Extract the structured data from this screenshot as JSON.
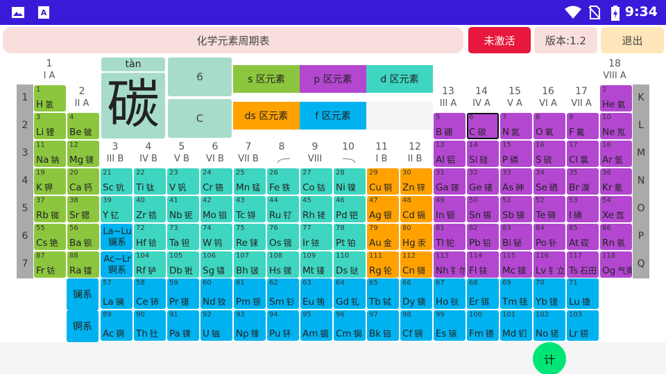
{
  "status_bar": {
    "time": "9:34",
    "icons": [
      "image-icon",
      "text-a-icon",
      "wifi-icon",
      "no-sim-icon",
      "battery-charging-icon"
    ]
  },
  "header": {
    "title": "化学元素周期表",
    "activate": "未激活",
    "version": "版本:1.2",
    "exit": "退出"
  },
  "detail": {
    "pinyin": "tàn",
    "character": "碳",
    "number": "6",
    "symbol": "C"
  },
  "legend": {
    "s": "s 区元素",
    "p": "p 区元素",
    "d": "d 区元素",
    "ds": "ds 区元素",
    "f": "f 区元素"
  },
  "periods": [
    "1",
    "2",
    "3",
    "4",
    "5",
    "6",
    "7"
  ],
  "shells": [
    "K",
    "L",
    "M",
    "N",
    "O",
    "P",
    "Q"
  ],
  "groups": [
    {
      "n": "1",
      "r": "I A"
    },
    {
      "n": "2",
      "r": "II A"
    },
    {
      "n": "3",
      "r": "III B"
    },
    {
      "n": "4",
      "r": "IV B"
    },
    {
      "n": "5",
      "r": "V B"
    },
    {
      "n": "6",
      "r": "VI B"
    },
    {
      "n": "7",
      "r": "VII B"
    },
    {
      "n": "8",
      "r": ""
    },
    {
      "n": "9",
      "r": "VIII"
    },
    {
      "n": "10",
      "r": ""
    },
    {
      "n": "11",
      "r": "I B"
    },
    {
      "n": "12",
      "r": "II B"
    },
    {
      "n": "13",
      "r": "III A"
    },
    {
      "n": "14",
      "r": "IV A"
    },
    {
      "n": "15",
      "r": "V A"
    },
    {
      "n": "16",
      "r": "VI A"
    },
    {
      "n": "17",
      "r": "VII A"
    },
    {
      "n": "18",
      "r": "VIII A"
    }
  ],
  "lan_ref": "La~Lu 镧系",
  "act_ref": "Ac~Lr 锕系",
  "series_labels": {
    "lanthanides": "镧系",
    "actinides": "锕系"
  },
  "elements": [
    {
      "z": "1",
      "s": "H",
      "c": "氢",
      "g": 1,
      "p": 1,
      "b": "s"
    },
    {
      "z": "2",
      "s": "He",
      "c": "氦",
      "g": 18,
      "p": 1,
      "b": "p"
    },
    {
      "z": "3",
      "s": "Li",
      "c": "锂",
      "g": 1,
      "p": 2,
      "b": "s"
    },
    {
      "z": "4",
      "s": "Be",
      "c": "铍",
      "g": 2,
      "p": 2,
      "b": "s"
    },
    {
      "z": "5",
      "s": "B",
      "c": "硼",
      "g": 13,
      "p": 2,
      "b": "p"
    },
    {
      "z": "6",
      "s": "C",
      "c": "碳",
      "g": 14,
      "p": 2,
      "b": "p",
      "sel": true
    },
    {
      "z": "7",
      "s": "N",
      "c": "氮",
      "g": 15,
      "p": 2,
      "b": "p"
    },
    {
      "z": "8",
      "s": "O",
      "c": "氧",
      "g": 16,
      "p": 2,
      "b": "p"
    },
    {
      "z": "9",
      "s": "F",
      "c": "氟",
      "g": 17,
      "p": 2,
      "b": "p"
    },
    {
      "z": "10",
      "s": "Ne",
      "c": "氖",
      "g": 18,
      "p": 2,
      "b": "p"
    },
    {
      "z": "11",
      "s": "Na",
      "c": "钠",
      "g": 1,
      "p": 3,
      "b": "s"
    },
    {
      "z": "12",
      "s": "Mg",
      "c": "镁",
      "g": 2,
      "p": 3,
      "b": "s"
    },
    {
      "z": "13",
      "s": "Al",
      "c": "铝",
      "g": 13,
      "p": 3,
      "b": "p"
    },
    {
      "z": "14",
      "s": "Si",
      "c": "硅",
      "g": 14,
      "p": 3,
      "b": "p"
    },
    {
      "z": "15",
      "s": "P",
      "c": "磷",
      "g": 15,
      "p": 3,
      "b": "p"
    },
    {
      "z": "16",
      "s": "S",
      "c": "硫",
      "g": 16,
      "p": 3,
      "b": "p"
    },
    {
      "z": "17",
      "s": "Cl",
      "c": "氯",
      "g": 17,
      "p": 3,
      "b": "p"
    },
    {
      "z": "18",
      "s": "Ar",
      "c": "氩",
      "g": 18,
      "p": 3,
      "b": "p"
    },
    {
      "z": "19",
      "s": "K",
      "c": "钾",
      "g": 1,
      "p": 4,
      "b": "s"
    },
    {
      "z": "20",
      "s": "Ca",
      "c": "钙",
      "g": 2,
      "p": 4,
      "b": "s"
    },
    {
      "z": "21",
      "s": "Sc",
      "c": "钪",
      "g": 3,
      "p": 4,
      "b": "d"
    },
    {
      "z": "22",
      "s": "Ti",
      "c": "钛",
      "g": 4,
      "p": 4,
      "b": "d"
    },
    {
      "z": "23",
      "s": "V",
      "c": "钒",
      "g": 5,
      "p": 4,
      "b": "d"
    },
    {
      "z": "24",
      "s": "Cr",
      "c": "铬",
      "g": 6,
      "p": 4,
      "b": "d"
    },
    {
      "z": "25",
      "s": "Mn",
      "c": "锰",
      "g": 7,
      "p": 4,
      "b": "d"
    },
    {
      "z": "26",
      "s": "Fe",
      "c": "铁",
      "g": 8,
      "p": 4,
      "b": "d"
    },
    {
      "z": "27",
      "s": "Co",
      "c": "钴",
      "g": 9,
      "p": 4,
      "b": "d"
    },
    {
      "z": "28",
      "s": "Ni",
      "c": "镍",
      "g": 10,
      "p": 4,
      "b": "d"
    },
    {
      "z": "29",
      "s": "Cu",
      "c": "铜",
      "g": 11,
      "p": 4,
      "b": "ds"
    },
    {
      "z": "30",
      "s": "Zn",
      "c": "锌",
      "g": 12,
      "p": 4,
      "b": "ds"
    },
    {
      "z": "31",
      "s": "Ga",
      "c": "镓",
      "g": 13,
      "p": 4,
      "b": "p"
    },
    {
      "z": "32",
      "s": "Ge",
      "c": "锗",
      "g": 14,
      "p": 4,
      "b": "p"
    },
    {
      "z": "33",
      "s": "As",
      "c": "砷",
      "g": 15,
      "p": 4,
      "b": "p"
    },
    {
      "z": "34",
      "s": "Se",
      "c": "硒",
      "g": 16,
      "p": 4,
      "b": "p"
    },
    {
      "z": "35",
      "s": "Br",
      "c": "溴",
      "g": 17,
      "p": 4,
      "b": "p"
    },
    {
      "z": "36",
      "s": "Kr",
      "c": "氪",
      "g": 18,
      "p": 4,
      "b": "p"
    },
    {
      "z": "37",
      "s": "Rb",
      "c": "铷",
      "g": 1,
      "p": 5,
      "b": "s"
    },
    {
      "z": "38",
      "s": "Sr",
      "c": "锶",
      "g": 2,
      "p": 5,
      "b": "s"
    },
    {
      "z": "39",
      "s": "Y",
      "c": "钇",
      "g": 3,
      "p": 5,
      "b": "d"
    },
    {
      "z": "40",
      "s": "Zr",
      "c": "锆",
      "g": 4,
      "p": 5,
      "b": "d"
    },
    {
      "z": "41",
      "s": "Nb",
      "c": "铌",
      "g": 5,
      "p": 5,
      "b": "d"
    },
    {
      "z": "42",
      "s": "Mo",
      "c": "钼",
      "g": 6,
      "p": 5,
      "b": "d"
    },
    {
      "z": "43",
      "s": "Tc",
      "c": "锝",
      "g": 7,
      "p": 5,
      "b": "d"
    },
    {
      "z": "44",
      "s": "Ru",
      "c": "钌",
      "g": 8,
      "p": 5,
      "b": "d"
    },
    {
      "z": "45",
      "s": "Rh",
      "c": "铑",
      "g": 9,
      "p": 5,
      "b": "d"
    },
    {
      "z": "46",
      "s": "Pd",
      "c": "钯",
      "g": 10,
      "p": 5,
      "b": "d"
    },
    {
      "z": "47",
      "s": "Ag",
      "c": "银",
      "g": 11,
      "p": 5,
      "b": "ds"
    },
    {
      "z": "48",
      "s": "Cd",
      "c": "镉",
      "g": 12,
      "p": 5,
      "b": "ds"
    },
    {
      "z": "49",
      "s": "In",
      "c": "铟",
      "g": 13,
      "p": 5,
      "b": "p"
    },
    {
      "z": "50",
      "s": "Sn",
      "c": "锡",
      "g": 14,
      "p": 5,
      "b": "p"
    },
    {
      "z": "51",
      "s": "Sb",
      "c": "锑",
      "g": 15,
      "p": 5,
      "b": "p"
    },
    {
      "z": "52",
      "s": "Te",
      "c": "碲",
      "g": 16,
      "p": 5,
      "b": "p"
    },
    {
      "z": "53",
      "s": "I",
      "c": "碘",
      "g": 17,
      "p": 5,
      "b": "p"
    },
    {
      "z": "54",
      "s": "Xe",
      "c": "氙",
      "g": 18,
      "p": 5,
      "b": "p"
    },
    {
      "z": "55",
      "s": "Cs",
      "c": "铯",
      "g": 1,
      "p": 6,
      "b": "s"
    },
    {
      "z": "56",
      "s": "Ba",
      "c": "钡",
      "g": 2,
      "p": 6,
      "b": "s"
    },
    {
      "z": "72",
      "s": "Hf",
      "c": "铪",
      "g": 4,
      "p": 6,
      "b": "d"
    },
    {
      "z": "73",
      "s": "Ta",
      "c": "钽",
      "g": 5,
      "p": 6,
      "b": "d"
    },
    {
      "z": "74",
      "s": "W",
      "c": "钨",
      "g": 6,
      "p": 6,
      "b": "d"
    },
    {
      "z": "75",
      "s": "Re",
      "c": "铼",
      "g": 7,
      "p": 6,
      "b": "d"
    },
    {
      "z": "76",
      "s": "Os",
      "c": "锇",
      "g": 8,
      "p": 6,
      "b": "d"
    },
    {
      "z": "77",
      "s": "Ir",
      "c": "铱",
      "g": 9,
      "p": 6,
      "b": "d"
    },
    {
      "z": "78",
      "s": "Pt",
      "c": "铂",
      "g": 10,
      "p": 6,
      "b": "d"
    },
    {
      "z": "79",
      "s": "Au",
      "c": "金",
      "g": 11,
      "p": 6,
      "b": "ds"
    },
    {
      "z": "80",
      "s": "Hg",
      "c": "汞",
      "g": 12,
      "p": 6,
      "b": "ds"
    },
    {
      "z": "81",
      "s": "Tl",
      "c": "铊",
      "g": 13,
      "p": 6,
      "b": "p"
    },
    {
      "z": "82",
      "s": "Pb",
      "c": "铅",
      "g": 14,
      "p": 6,
      "b": "p"
    },
    {
      "z": "83",
      "s": "Bi",
      "c": "铋",
      "g": 15,
      "p": 6,
      "b": "p"
    },
    {
      "z": "84",
      "s": "Po",
      "c": "钋",
      "g": 16,
      "p": 6,
      "b": "p"
    },
    {
      "z": "85",
      "s": "At",
      "c": "砹",
      "g": 17,
      "p": 6,
      "b": "p"
    },
    {
      "z": "86",
      "s": "Rn",
      "c": "氡",
      "g": 18,
      "p": 6,
      "b": "p"
    },
    {
      "z": "87",
      "s": "Fr",
      "c": "钫",
      "g": 1,
      "p": 7,
      "b": "s"
    },
    {
      "z": "88",
      "s": "Ra",
      "c": "镭",
      "g": 2,
      "p": 7,
      "b": "s"
    },
    {
      "z": "104",
      "s": "Rf",
      "c": "𬬻",
      "g": 4,
      "p": 7,
      "b": "d"
    },
    {
      "z": "105",
      "s": "Db",
      "c": "𬭊",
      "g": 5,
      "p": 7,
      "b": "d"
    },
    {
      "z": "106",
      "s": "Sg",
      "c": "𬭳",
      "g": 6,
      "p": 7,
      "b": "d"
    },
    {
      "z": "107",
      "s": "Bh",
      "c": "𬭛",
      "g": 7,
      "p": 7,
      "b": "d"
    },
    {
      "z": "108",
      "s": "Hs",
      "c": "𬭶",
      "g": 8,
      "p": 7,
      "b": "d"
    },
    {
      "z": "109",
      "s": "Mt",
      "c": "鿏",
      "g": 9,
      "p": 7,
      "b": "d"
    },
    {
      "z": "110",
      "s": "Ds",
      "c": "𫟼",
      "g": 10,
      "p": 7,
      "b": "d"
    },
    {
      "z": "111",
      "s": "Rg",
      "c": "𬬭",
      "g": 11,
      "p": 7,
      "b": "ds"
    },
    {
      "z": "112",
      "s": "Cn",
      "c": "鿔",
      "g": 12,
      "p": 7,
      "b": "ds"
    },
    {
      "z": "113",
      "s": "Nh",
      "c": "钅尔",
      "g": 13,
      "p": 7,
      "b": "p"
    },
    {
      "z": "114",
      "s": "Fl",
      "c": "𫓧",
      "g": 14,
      "p": 7,
      "b": "p"
    },
    {
      "z": "115",
      "s": "Mc",
      "c": "镆",
      "g": 15,
      "p": 7,
      "b": "p"
    },
    {
      "z": "116",
      "s": "Lv",
      "c": "钅立",
      "g": 16,
      "p": 7,
      "b": "p"
    },
    {
      "z": "117",
      "s": "Ts",
      "c": "石田",
      "g": 17,
      "p": 7,
      "b": "p"
    },
    {
      "z": "118",
      "s": "Og",
      "c": "气奥",
      "g": 18,
      "p": 7,
      "b": "p"
    }
  ],
  "lanthanides": [
    {
      "z": "57",
      "s": "La",
      "c": "镧"
    },
    {
      "z": "58",
      "s": "Ce",
      "c": "铈"
    },
    {
      "z": "59",
      "s": "Pr",
      "c": "镨"
    },
    {
      "z": "60",
      "s": "Nd",
      "c": "钕"
    },
    {
      "z": "61",
      "s": "Pm",
      "c": "钷"
    },
    {
      "z": "62",
      "s": "Sm",
      "c": "钐"
    },
    {
      "z": "63",
      "s": "Eu",
      "c": "铕"
    },
    {
      "z": "64",
      "s": "Gd",
      "c": "钆"
    },
    {
      "z": "65",
      "s": "Tb",
      "c": "铽"
    },
    {
      "z": "66",
      "s": "Dy",
      "c": "镝"
    },
    {
      "z": "67",
      "s": "Ho",
      "c": "钬"
    },
    {
      "z": "68",
      "s": "Er",
      "c": "铒"
    },
    {
      "z": "69",
      "s": "Tm",
      "c": "铥"
    },
    {
      "z": "70",
      "s": "Yb",
      "c": "镱"
    },
    {
      "z": "71",
      "s": "Lu",
      "c": "镥"
    }
  ],
  "actinides": [
    {
      "z": "89",
      "s": "Ac",
      "c": "锕"
    },
    {
      "z": "90",
      "s": "Th",
      "c": "钍"
    },
    {
      "z": "91",
      "s": "Pa",
      "c": "镤"
    },
    {
      "z": "92",
      "s": "U",
      "c": "铀"
    },
    {
      "z": "93",
      "s": "Np",
      "c": "镎"
    },
    {
      "z": "94",
      "s": "Pu",
      "c": "钚"
    },
    {
      "z": "95",
      "s": "Am",
      "c": "镅"
    },
    {
      "z": "96",
      "s": "Cm",
      "c": "锔"
    },
    {
      "z": "97",
      "s": "Bk",
      "c": "锫"
    },
    {
      "z": "98",
      "s": "Cf",
      "c": "锎"
    },
    {
      "z": "99",
      "s": "Es",
      "c": "锿"
    },
    {
      "z": "100",
      "s": "Fm",
      "c": "镄"
    },
    {
      "z": "101",
      "s": "Md",
      "c": "钔"
    },
    {
      "z": "102",
      "s": "No",
      "c": "锘"
    },
    {
      "z": "103",
      "s": "Lr",
      "c": "铹"
    }
  ],
  "fab": {
    "label": "计"
  },
  "colors": {
    "status_bar": "#3a1ad8",
    "s_block": "#8cc63e",
    "p_block": "#b347d0",
    "d_block": "#3ed6c1",
    "ds_block": "#ffa200",
    "f_block": "#00b3f0",
    "activate": "#e8173d",
    "fab": "#00e676"
  }
}
